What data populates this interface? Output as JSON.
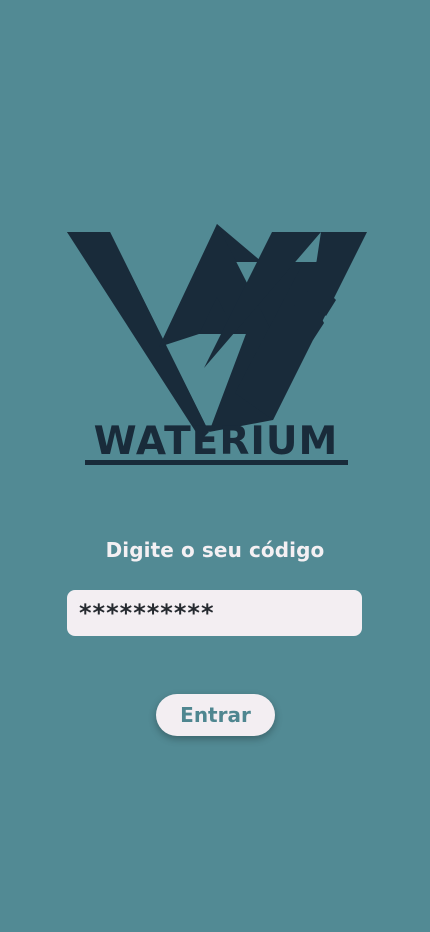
{
  "app": {
    "background_color": "#528a94",
    "logo_color": "#192b3a"
  },
  "logo": {
    "icon": "waterium-logo",
    "wordmark": "WATERIUM"
  },
  "form": {
    "label": "Digite o seu código",
    "code_value": "**********",
    "button_label": "Entrar"
  }
}
